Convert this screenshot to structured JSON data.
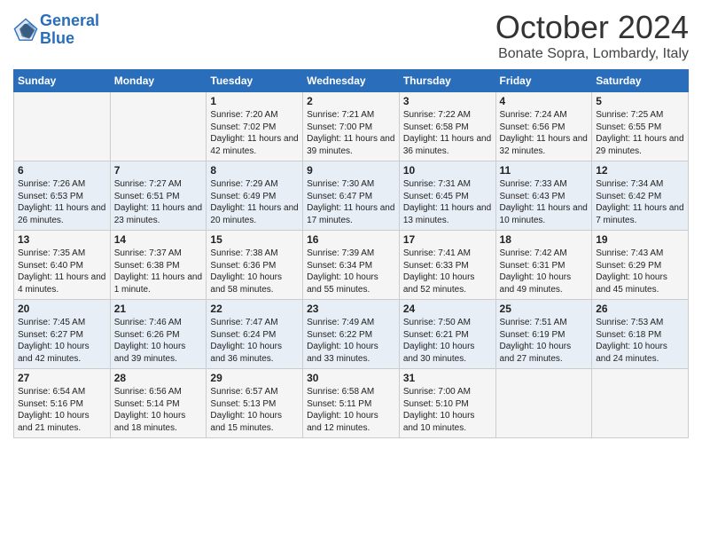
{
  "logo": {
    "line1": "General",
    "line2": "Blue"
  },
  "title": "October 2024",
  "location": "Bonate Sopra, Lombardy, Italy",
  "headers": [
    "Sunday",
    "Monday",
    "Tuesday",
    "Wednesday",
    "Thursday",
    "Friday",
    "Saturday"
  ],
  "weeks": [
    [
      {
        "day": "",
        "info": ""
      },
      {
        "day": "",
        "info": ""
      },
      {
        "day": "1",
        "info": "Sunrise: 7:20 AM\nSunset: 7:02 PM\nDaylight: 11 hours and 42 minutes."
      },
      {
        "day": "2",
        "info": "Sunrise: 7:21 AM\nSunset: 7:00 PM\nDaylight: 11 hours and 39 minutes."
      },
      {
        "day": "3",
        "info": "Sunrise: 7:22 AM\nSunset: 6:58 PM\nDaylight: 11 hours and 36 minutes."
      },
      {
        "day": "4",
        "info": "Sunrise: 7:24 AM\nSunset: 6:56 PM\nDaylight: 11 hours and 32 minutes."
      },
      {
        "day": "5",
        "info": "Sunrise: 7:25 AM\nSunset: 6:55 PM\nDaylight: 11 hours and 29 minutes."
      }
    ],
    [
      {
        "day": "6",
        "info": "Sunrise: 7:26 AM\nSunset: 6:53 PM\nDaylight: 11 hours and 26 minutes."
      },
      {
        "day": "7",
        "info": "Sunrise: 7:27 AM\nSunset: 6:51 PM\nDaylight: 11 hours and 23 minutes."
      },
      {
        "day": "8",
        "info": "Sunrise: 7:29 AM\nSunset: 6:49 PM\nDaylight: 11 hours and 20 minutes."
      },
      {
        "day": "9",
        "info": "Sunrise: 7:30 AM\nSunset: 6:47 PM\nDaylight: 11 hours and 17 minutes."
      },
      {
        "day": "10",
        "info": "Sunrise: 7:31 AM\nSunset: 6:45 PM\nDaylight: 11 hours and 13 minutes."
      },
      {
        "day": "11",
        "info": "Sunrise: 7:33 AM\nSunset: 6:43 PM\nDaylight: 11 hours and 10 minutes."
      },
      {
        "day": "12",
        "info": "Sunrise: 7:34 AM\nSunset: 6:42 PM\nDaylight: 11 hours and 7 minutes."
      }
    ],
    [
      {
        "day": "13",
        "info": "Sunrise: 7:35 AM\nSunset: 6:40 PM\nDaylight: 11 hours and 4 minutes."
      },
      {
        "day": "14",
        "info": "Sunrise: 7:37 AM\nSunset: 6:38 PM\nDaylight: 11 hours and 1 minute."
      },
      {
        "day": "15",
        "info": "Sunrise: 7:38 AM\nSunset: 6:36 PM\nDaylight: 10 hours and 58 minutes."
      },
      {
        "day": "16",
        "info": "Sunrise: 7:39 AM\nSunset: 6:34 PM\nDaylight: 10 hours and 55 minutes."
      },
      {
        "day": "17",
        "info": "Sunrise: 7:41 AM\nSunset: 6:33 PM\nDaylight: 10 hours and 52 minutes."
      },
      {
        "day": "18",
        "info": "Sunrise: 7:42 AM\nSunset: 6:31 PM\nDaylight: 10 hours and 49 minutes."
      },
      {
        "day": "19",
        "info": "Sunrise: 7:43 AM\nSunset: 6:29 PM\nDaylight: 10 hours and 45 minutes."
      }
    ],
    [
      {
        "day": "20",
        "info": "Sunrise: 7:45 AM\nSunset: 6:27 PM\nDaylight: 10 hours and 42 minutes."
      },
      {
        "day": "21",
        "info": "Sunrise: 7:46 AM\nSunset: 6:26 PM\nDaylight: 10 hours and 39 minutes."
      },
      {
        "day": "22",
        "info": "Sunrise: 7:47 AM\nSunset: 6:24 PM\nDaylight: 10 hours and 36 minutes."
      },
      {
        "day": "23",
        "info": "Sunrise: 7:49 AM\nSunset: 6:22 PM\nDaylight: 10 hours and 33 minutes."
      },
      {
        "day": "24",
        "info": "Sunrise: 7:50 AM\nSunset: 6:21 PM\nDaylight: 10 hours and 30 minutes."
      },
      {
        "day": "25",
        "info": "Sunrise: 7:51 AM\nSunset: 6:19 PM\nDaylight: 10 hours and 27 minutes."
      },
      {
        "day": "26",
        "info": "Sunrise: 7:53 AM\nSunset: 6:18 PM\nDaylight: 10 hours and 24 minutes."
      }
    ],
    [
      {
        "day": "27",
        "info": "Sunrise: 6:54 AM\nSunset: 5:16 PM\nDaylight: 10 hours and 21 minutes."
      },
      {
        "day": "28",
        "info": "Sunrise: 6:56 AM\nSunset: 5:14 PM\nDaylight: 10 hours and 18 minutes."
      },
      {
        "day": "29",
        "info": "Sunrise: 6:57 AM\nSunset: 5:13 PM\nDaylight: 10 hours and 15 minutes."
      },
      {
        "day": "30",
        "info": "Sunrise: 6:58 AM\nSunset: 5:11 PM\nDaylight: 10 hours and 12 minutes."
      },
      {
        "day": "31",
        "info": "Sunrise: 7:00 AM\nSunset: 5:10 PM\nDaylight: 10 hours and 10 minutes."
      },
      {
        "day": "",
        "info": ""
      },
      {
        "day": "",
        "info": ""
      }
    ]
  ]
}
